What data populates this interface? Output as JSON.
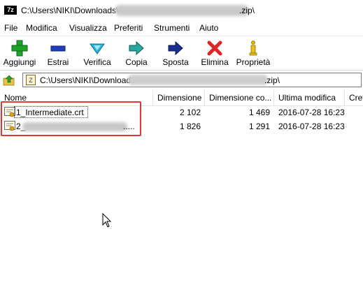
{
  "window": {
    "app_badge": "7z",
    "title_prefix": "C:\\Users\\NIKI\\Downloads\\",
    "title_suffix": ".zip\\"
  },
  "menu": [
    "File",
    "Modifica",
    "Visualizza",
    "Preferiti",
    "Strumenti",
    "Aiuto"
  ],
  "toolbar": {
    "add": "Aggiungi",
    "extract": "Estrai",
    "test": "Verifica",
    "copy": "Copia",
    "move": "Sposta",
    "delete": "Elimina",
    "info": "Proprietà"
  },
  "address": {
    "prefix": "C:\\Users\\NIKI\\Downloads\\",
    "suffix": ".zip\\"
  },
  "columns": {
    "name": "Nome",
    "size": "Dimensione",
    "packed": "Dimensione co...",
    "modified": "Ultima modifica",
    "created": "Cre"
  },
  "files": [
    {
      "name": "1_Intermediate.crt",
      "size": "2 102",
      "packed": "1 469",
      "modified": "2016-07-28 16:23"
    },
    {
      "name_start": "2_",
      "name_end": ".....",
      "size": "1 826",
      "packed": "1 291",
      "modified": "2016-07-28 16:23"
    }
  ],
  "colors": {
    "highlight": "#e53535",
    "add_icon": "#1fa32a",
    "extract_icon": "#1f3fbf",
    "delete_icon": "#e02424"
  }
}
